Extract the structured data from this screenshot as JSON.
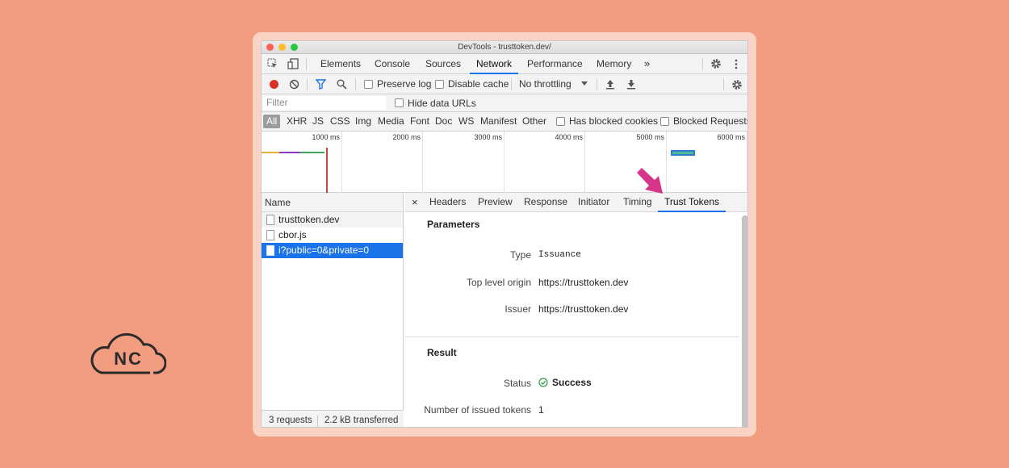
{
  "window": {
    "title": "DevTools - trusttoken.dev/"
  },
  "main_tabs": [
    "Elements",
    "Console",
    "Sources",
    "Network",
    "Performance",
    "Memory"
  ],
  "more_tabs_glyph": "»",
  "toolbar": {
    "preserve_log": "Preserve log",
    "disable_cache": "Disable cache",
    "throttling": "No throttling"
  },
  "filter": {
    "placeholder": "Filter",
    "hide_data_urls": "Hide data URLs"
  },
  "type_filters": [
    "All",
    "XHR",
    "JS",
    "CSS",
    "Img",
    "Media",
    "Font",
    "Doc",
    "WS",
    "Manifest",
    "Other"
  ],
  "has_blocked_cookies": "Has blocked cookies",
  "blocked_requests": "Blocked Requests",
  "timeline": {
    "labels": [
      "1000 ms",
      "2000 ms",
      "3000 ms",
      "4000 ms",
      "5000 ms",
      "6000 ms"
    ]
  },
  "requests": {
    "header": "Name",
    "items": [
      "trusttoken.dev",
      "cbor.js",
      "i?public=0&private=0"
    ],
    "selected": 2
  },
  "status": {
    "requests": "3 requests",
    "transferred": "2.2 kB transferred"
  },
  "detail": {
    "close": "×",
    "tabs": [
      "Headers",
      "Preview",
      "Response",
      "Initiator",
      "Timing",
      "Trust Tokens"
    ],
    "active_tab": "Trust Tokens",
    "parameters": {
      "title": "Parameters",
      "type_label": "Type",
      "type_value": "Issuance",
      "origin_label": "Top level origin",
      "origin_value": "https://trusttoken.dev",
      "issuer_label": "Issuer",
      "issuer_value": "https://trusttoken.dev"
    },
    "result": {
      "title": "Result",
      "status_label": "Status",
      "status_value": "Success",
      "tokens_label": "Number of issued tokens",
      "tokens_value": "1"
    }
  },
  "logo": {
    "text": "NC"
  },
  "colors": {
    "background": "#f39d80",
    "accent": "#1a73e8",
    "arrow": "#d6358a",
    "success": "#2e9b4a",
    "record": "#d93025"
  }
}
